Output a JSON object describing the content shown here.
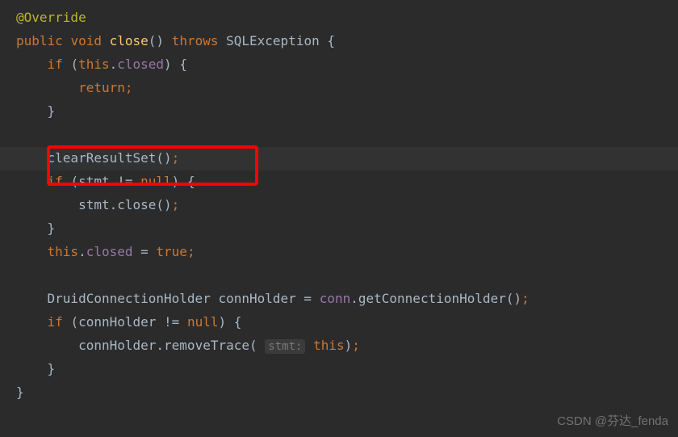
{
  "code": {
    "override": "@Override",
    "kw_public": "public",
    "kw_void": "void",
    "fn_close": "close",
    "parens_empty": "()",
    "kw_throws": "throws",
    "exc_type": "SQLException",
    "brace_open": " {",
    "kw_if": "if",
    "kw_this": "this",
    "field_closed": "closed",
    "kw_return": "return",
    "semi": ";",
    "brace_close": "}",
    "fn_clearResultSet": "clearResultSet",
    "var_stmt": "stmt",
    "neq": " != ",
    "kw_null": "null",
    "dot": ".",
    "assign_true": " = ",
    "kw_true": "true",
    "type_holder": "DruidConnectionHolder",
    "var_connHolder": "connHolder",
    "var_conn": "conn",
    "fn_getConnHolder": "getConnectionHolder",
    "fn_removeTrace": "removeTrace",
    "hint_stmt": "stmt:",
    "indent1": "    ",
    "indent2": "        ",
    "lparen": "(",
    "rparen": ")",
    "space": " "
  },
  "watermark": "CSDN @芬达_fenda"
}
